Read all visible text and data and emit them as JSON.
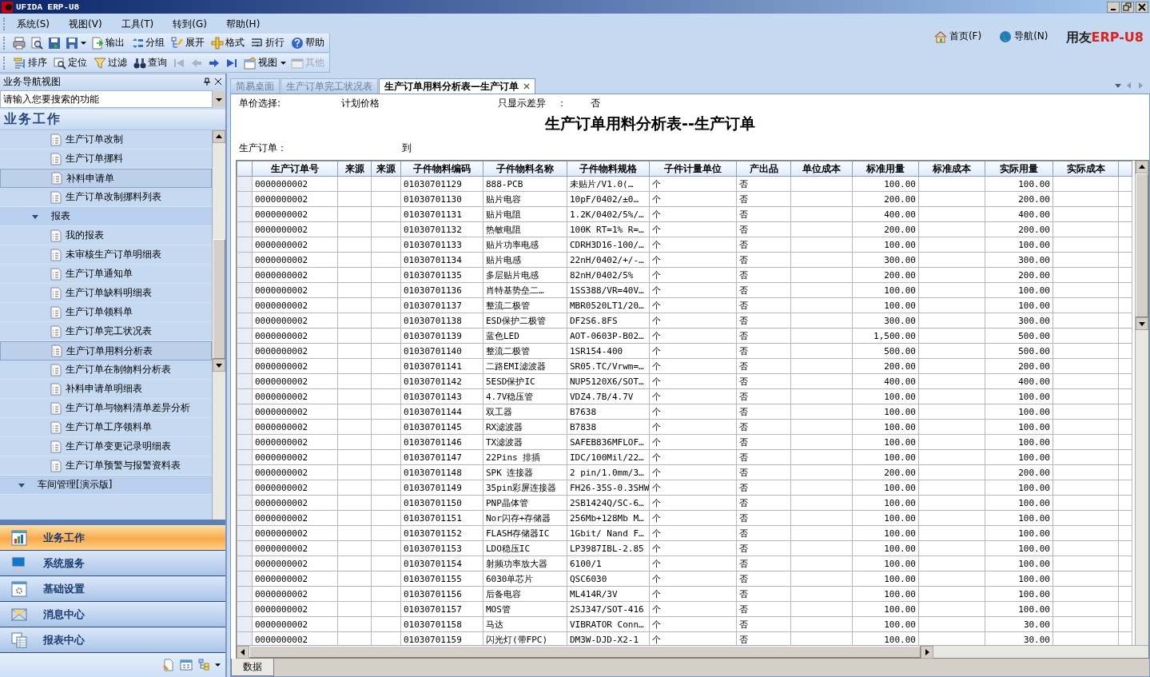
{
  "window": {
    "title": "UFIDA ERP-U8"
  },
  "menu": [
    "系统(S)",
    "视图(V)",
    "工具(T)",
    "转到(G)",
    "帮助(H)"
  ],
  "top_links": [
    {
      "label": "首页(F)"
    },
    {
      "label": "导航(N)"
    }
  ],
  "logo": {
    "brand": "用友",
    "product": "ERP-U8"
  },
  "toolbar_1": [
    {
      "kind": "icon"
    },
    {
      "kind": "icon"
    },
    {
      "kind": "icon"
    },
    {
      "kind": "icon_dropdown"
    },
    {
      "kind": "labeled",
      "label": "输出"
    },
    {
      "kind": "labeled",
      "label": "分组"
    },
    {
      "kind": "labeled",
      "label": "展开"
    },
    {
      "kind": "labeled",
      "label": "格式"
    },
    {
      "kind": "labeled",
      "label": "折行"
    },
    {
      "kind": "labeled",
      "label": "帮助"
    }
  ],
  "toolbar_2": [
    {
      "kind": "labeled",
      "label": "排序",
      "disabled": false
    },
    {
      "kind": "labeled",
      "label": "定位",
      "disabled": false
    },
    {
      "kind": "labeled",
      "label": "过滤",
      "disabled": false
    },
    {
      "kind": "labeled",
      "label": "查询",
      "disabled": false
    },
    {
      "kind": "icon",
      "disabled": true
    },
    {
      "kind": "icon",
      "disabled": true
    },
    {
      "kind": "icon",
      "disabled": false
    },
    {
      "kind": "icon",
      "disabled": false
    },
    {
      "kind": "labeled_dropdown",
      "label": "视图",
      "disabled": false
    },
    {
      "kind": "labeled",
      "label": "其他",
      "disabled": true
    }
  ],
  "sidebar": {
    "title": "业务导航视图",
    "search_placeholder": "请输入您要搜索的功能",
    "section": "业务工作",
    "tree": [
      {
        "label": "生产订单改制",
        "selected": false
      },
      {
        "label": "生产订单挪料",
        "selected": false
      },
      {
        "label": "补料申请单",
        "selected": true
      },
      {
        "label": "生产订单改制挪料列表",
        "selected": false
      },
      {
        "label": "报表",
        "expanded": true,
        "children": [
          {
            "label": "我的报表",
            "selected": false
          },
          {
            "label": "未审核生产订单明细表",
            "selected": false
          },
          {
            "label": "生产订单通知单",
            "selected": false
          },
          {
            "label": "生产订单缺料明细表",
            "selected": false
          },
          {
            "label": "生产订单领料单",
            "selected": false
          },
          {
            "label": "生产订单完工状况表",
            "selected": false
          },
          {
            "label": "生产订单用料分析表",
            "selected": true
          },
          {
            "label": "生产订单在制物料分析表",
            "selected": false
          },
          {
            "label": "补料申请单明细表",
            "selected": false
          },
          {
            "label": "生产订单与物料清单差异分析",
            "selected": false
          },
          {
            "label": "生产订单工序领料单",
            "selected": false
          },
          {
            "label": "生产订单变更记录明细表",
            "selected": false
          },
          {
            "label": "生产订单预警与报警资料表",
            "selected": false
          }
        ]
      }
    ],
    "next_group": {
      "label": "车间管理[演示版]",
      "expanded": true
    },
    "nav_buttons": [
      {
        "label": "业务工作",
        "selected": true
      },
      {
        "label": "系统服务",
        "selected": false
      },
      {
        "label": "基础设置",
        "selected": false
      },
      {
        "label": "消息中心",
        "selected": false
      },
      {
        "label": "报表中心",
        "selected": false
      }
    ]
  },
  "tabs": [
    {
      "label": "简易桌面",
      "selected": false
    },
    {
      "label": "生产订单完工状况表",
      "selected": false
    },
    {
      "label": "生产订单用料分析表—生产订单",
      "selected": true,
      "closable": true
    }
  ],
  "report": {
    "price_label": "单价选择:",
    "price_value": "计划价格",
    "diff_label": "只显示差异",
    "diff_colon": "：",
    "diff_value": "否",
    "title": "生产订单用料分析表--生产订单",
    "order_label": "生产订单：",
    "order_to": "到"
  },
  "table": {
    "columns": [
      "生产订单号",
      "来源",
      "来源",
      "子件物料编码",
      "子件物料名称",
      "子件物料规格",
      "子件计量单位",
      "产出品",
      "单位成本",
      "标准用量",
      "标准成本",
      "实际用量",
      "实际成本"
    ],
    "rows": [
      {
        "order": "0000000002",
        "code": "01030701129",
        "name": "888-PCB",
        "spec": "未贴片/V1.0(…",
        "unit": "个",
        "output": "否",
        "std_qty": "100.00",
        "act_qty": "100.00"
      },
      {
        "order": "0000000002",
        "code": "01030701130",
        "name": "贴片电容",
        "spec": "10pF/0402/±0…",
        "unit": "个",
        "output": "否",
        "std_qty": "200.00",
        "act_qty": "200.00"
      },
      {
        "order": "0000000002",
        "code": "01030701131",
        "name": "贴片电阻",
        "spec": "1.2K/0402/5%/…",
        "unit": "个",
        "output": "否",
        "std_qty": "400.00",
        "act_qty": "400.00"
      },
      {
        "order": "0000000002",
        "code": "01030701132",
        "name": "热敏电阻",
        "spec": "100K RT=1% R=…",
        "unit": "个",
        "output": "否",
        "std_qty": "200.00",
        "act_qty": "200.00"
      },
      {
        "order": "0000000002",
        "code": "01030701133",
        "name": "贴片功率电感",
        "spec": "CDRH3D16-100/…",
        "unit": "个",
        "output": "否",
        "std_qty": "100.00",
        "act_qty": "100.00"
      },
      {
        "order": "0000000002",
        "code": "01030701134",
        "name": "贴片电感",
        "spec": "22nH/0402/+/-…",
        "unit": "个",
        "output": "否",
        "std_qty": "300.00",
        "act_qty": "300.00"
      },
      {
        "order": "0000000002",
        "code": "01030701135",
        "name": "多层贴片电感",
        "spec": "82nH/0402/5%",
        "unit": "个",
        "output": "否",
        "std_qty": "200.00",
        "act_qty": "200.00"
      },
      {
        "order": "0000000002",
        "code": "01030701136",
        "name": "肖特基势垒二…",
        "spec": "1SS388/VR=40V…",
        "unit": "个",
        "output": "否",
        "std_qty": "100.00",
        "act_qty": "100.00"
      },
      {
        "order": "0000000002",
        "code": "01030701137",
        "name": "整流二极管",
        "spec": "MBR0520LT1/20…",
        "unit": "个",
        "output": "否",
        "std_qty": "100.00",
        "act_qty": "100.00"
      },
      {
        "order": "0000000002",
        "code": "01030701138",
        "name": "ESD保护二极管",
        "spec": "DF2S6.8FS",
        "unit": "个",
        "output": "否",
        "std_qty": "300.00",
        "act_qty": "300.00"
      },
      {
        "order": "0000000002",
        "code": "01030701139",
        "name": "蓝色LED",
        "spec": "AOT-0603P-B02…",
        "unit": "个",
        "output": "否",
        "std_qty": "1,500.00",
        "act_qty": "500.00"
      },
      {
        "order": "0000000002",
        "code": "01030701140",
        "name": "整流二极管",
        "spec": "1SR154-400",
        "unit": "个",
        "output": "否",
        "std_qty": "500.00",
        "act_qty": "500.00"
      },
      {
        "order": "0000000002",
        "code": "01030701141",
        "name": "二路EMI滤波器",
        "spec": "SR05.TC/Vrwm=…",
        "unit": "个",
        "output": "否",
        "std_qty": "200.00",
        "act_qty": "200.00"
      },
      {
        "order": "0000000002",
        "code": "01030701142",
        "name": "5ESD保护IC",
        "spec": "NUP5120X6/SOT…",
        "unit": "个",
        "output": "否",
        "std_qty": "400.00",
        "act_qty": "400.00"
      },
      {
        "order": "0000000002",
        "code": "01030701143",
        "name": "4.7V稳压管",
        "spec": "VDZ4.7B/4.7V",
        "unit": "个",
        "output": "否",
        "std_qty": "100.00",
        "act_qty": "100.00"
      },
      {
        "order": "0000000002",
        "code": "01030701144",
        "name": "双工器",
        "spec": "B7638",
        "unit": "个",
        "output": "否",
        "std_qty": "100.00",
        "act_qty": "100.00"
      },
      {
        "order": "0000000002",
        "code": "01030701145",
        "name": "RX滤波器",
        "spec": "B7838",
        "unit": "个",
        "output": "否",
        "std_qty": "100.00",
        "act_qty": "100.00"
      },
      {
        "order": "0000000002",
        "code": "01030701146",
        "name": "TX滤波器",
        "spec": "SAFEB836MFLOF…",
        "unit": "个",
        "output": "否",
        "std_qty": "100.00",
        "act_qty": "100.00"
      },
      {
        "order": "0000000002",
        "code": "01030701147",
        "name": "22Pins 排插",
        "spec": "IDC/100Mil/22…",
        "unit": "个",
        "output": "否",
        "std_qty": "100.00",
        "act_qty": "100.00"
      },
      {
        "order": "0000000002",
        "code": "01030701148",
        "name": "SPK 连接器",
        "spec": "2 pin/1.0mm/3…",
        "unit": "个",
        "output": "否",
        "std_qty": "200.00",
        "act_qty": "200.00"
      },
      {
        "order": "0000000002",
        "code": "01030701149",
        "name": "35pin彩屏连接器",
        "spec": "FH26-35S-0.3SHW",
        "unit": "个",
        "output": "否",
        "std_qty": "100.00",
        "act_qty": "100.00"
      },
      {
        "order": "0000000002",
        "code": "01030701150",
        "name": "PNP晶体管",
        "spec": "2SB1424Q/SC-6…",
        "unit": "个",
        "output": "否",
        "std_qty": "100.00",
        "act_qty": "100.00"
      },
      {
        "order": "0000000002",
        "code": "01030701151",
        "name": "Nor闪存+存储器",
        "spec": "256Mb+128Mb M…",
        "unit": "个",
        "output": "否",
        "std_qty": "100.00",
        "act_qty": "100.00"
      },
      {
        "order": "0000000002",
        "code": "01030701152",
        "name": "FLASH存储器IC",
        "spec": "1Gbit/ Nand F…",
        "unit": "个",
        "output": "否",
        "std_qty": "100.00",
        "act_qty": "100.00"
      },
      {
        "order": "0000000002",
        "code": "01030701153",
        "name": "LDO稳压IC",
        "spec": "LP3987IBL-2.85",
        "unit": "个",
        "output": "否",
        "std_qty": "100.00",
        "act_qty": "100.00"
      },
      {
        "order": "0000000002",
        "code": "01030701154",
        "name": "射频功率放大器",
        "spec": "6100/1",
        "unit": "个",
        "output": "否",
        "std_qty": "100.00",
        "act_qty": "100.00"
      },
      {
        "order": "0000000002",
        "code": "01030701155",
        "name": "6030单芯片",
        "spec": "QSC6030",
        "unit": "个",
        "output": "否",
        "std_qty": "100.00",
        "act_qty": "100.00"
      },
      {
        "order": "0000000002",
        "code": "01030701156",
        "name": "后备电容",
        "spec": "ML414R/3V",
        "unit": "个",
        "output": "否",
        "std_qty": "100.00",
        "act_qty": "100.00"
      },
      {
        "order": "0000000002",
        "code": "01030701157",
        "name": "MOS管",
        "spec": "2SJ347/SOT-416",
        "unit": "个",
        "output": "否",
        "std_qty": "100.00",
        "act_qty": "100.00"
      },
      {
        "order": "0000000002",
        "code": "01030701158",
        "name": "马达",
        "spec": "VIBRATOR Conn…",
        "unit": "个",
        "output": "否",
        "std_qty": "100.00",
        "act_qty": "30.00"
      },
      {
        "order": "0000000002",
        "code": "01030701159",
        "name": "闪光灯(带FPC)",
        "spec": "DM3W-DJD-X2-1",
        "unit": "个",
        "output": "否",
        "std_qty": "100.00",
        "act_qty": "30.00"
      }
    ]
  },
  "sheet_tabs": [
    {
      "label": "数据",
      "selected": true
    }
  ]
}
